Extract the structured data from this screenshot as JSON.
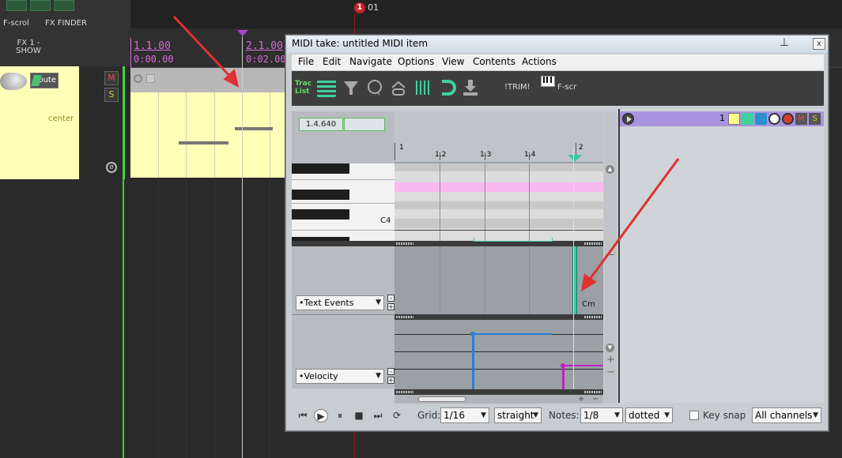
{
  "arrange": {
    "toolbar": {
      "label_fscroll": "F-scrol",
      "label_fxfinder": "FX FINDER",
      "label_fxshow": "FX 1 -\nSHOW"
    },
    "marker": {
      "number": "1",
      "label": "01"
    },
    "ruler": {
      "bar1_measure": "1.1.00",
      "bar1_time": "0:00.00",
      "bar2_measure": "2.1.00",
      "bar2_time": "0:02.00"
    },
    "track": {
      "route_label": "Route",
      "pan_label": "center",
      "mute_label": "M",
      "solo_label": "S"
    }
  },
  "midi_editor": {
    "title": "MIDI take: untitled MIDI item",
    "close_label": "x",
    "menu": [
      "File",
      "Edit",
      "Navigate",
      "Options",
      "View",
      "Contents",
      "Actions"
    ],
    "toolbar": {
      "track_list_line1": "Trac",
      "track_list_line2": "List",
      "trim_label": "!TRIM!",
      "fscr_label": "F-scr"
    },
    "position": "1.4.640",
    "ruler_labels": [
      "1",
      "1.2",
      "1.3",
      "1.4",
      "2"
    ],
    "piano_note_label": "C4",
    "lanes": {
      "text_events": "•Text Events",
      "velocity": "•Velocity"
    },
    "text_event": {
      "label": "Cm"
    },
    "lane_buttons": {
      "minus": "-",
      "plus": "+"
    },
    "bottom": {
      "grid_label": "Grid:",
      "grid_value": "1/16",
      "grid_type": "straight",
      "notes_label": "Notes:",
      "notes_value": "1/8",
      "notes_type": "dotted",
      "keysnap_label": "Key snap",
      "channels": "All channels"
    },
    "tracklist": {
      "track_number": "1"
    }
  },
  "colors": {
    "ruler_pink": "#d86cd8",
    "text_event_teal": "#39c9a1",
    "velocity_blue": "#2a7fd0",
    "velocity_magenta": "#c020c0",
    "track_purple": "#a994e0",
    "arrow_red": "#e03030"
  }
}
